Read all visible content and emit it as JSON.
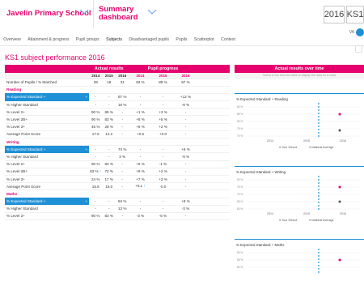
{
  "header": {
    "school": "Javelin Primary School",
    "dashboard_line1": "Summary",
    "dashboard_line2": "dashboard",
    "year": "2016",
    "stage": "KS1",
    "toggle_label": "VA"
  },
  "nav": [
    "Overview",
    "Attainment & progress",
    "Pupil groups",
    "Subjects",
    "Disadvantaged pupils",
    "Pupils",
    "Scatterplot",
    "Context"
  ],
  "nav_active": "Subjects",
  "page_title": "KS1 subject performance 2016",
  "table": {
    "actual_header": "Actual results",
    "progress_header": "Pupil progress",
    "over_time_header": "Actual results over time",
    "over_time_hint": "Select a row from the table to display the data on a chart",
    "years": [
      "2014",
      "2015",
      "2016"
    ],
    "pupils_label": "Number of Pupils / % Matched",
    "pupils": [
      "29",
      "18",
      "31",
      "93 %",
      "89 %",
      "97 %"
    ],
    "sections": [
      {
        "title": "Reading",
        "rows": [
          {
            "label": "% Expected Standard +",
            "v": [
              "-",
              "-",
              "87 %",
              "-",
              "-",
              "+12 %"
            ],
            "sel": true
          },
          {
            "label": "% Higher Standard",
            "v": [
              "-",
              "-",
              "16 %",
              "-",
              "-",
              "-8 %"
            ]
          },
          {
            "label": "% Level 2+",
            "v": [
              "90 %",
              "89 %",
              "-",
              "+1 %",
              "+3 %",
              "-"
            ]
          },
          {
            "label": "% Level 2B+",
            "v": [
              "90 %",
              "83 %",
              "-",
              "+8 %",
              "+5 %",
              "-"
            ]
          },
          {
            "label": "% Level 3+",
            "v": [
              "45 %",
              "28 %",
              "-",
              "+6 %",
              "+2 %",
              "-"
            ]
          },
          {
            "label": "Average Point Score",
            "v": [
              "17.5",
              "14.2",
              "-",
              "+0.5",
              "+0.0",
              "-"
            ]
          }
        ]
      },
      {
        "title": "Writing",
        "rows": [
          {
            "label": "% Expected Standard +",
            "v": [
              "-",
              "-",
              "74 %",
              "-",
              "-",
              "+6 %"
            ],
            "sel": true
          },
          {
            "label": "% Higher Standard",
            "v": [
              "-",
              "-",
              "3 %",
              "-",
              "-",
              "-9 %"
            ]
          },
          {
            "label": "% Level 2+",
            "v": [
              "90 %",
              "83 %",
              "-",
              "+6 %",
              "-1 %",
              "-"
            ]
          },
          {
            "label": "% Level 2B+",
            "v": [
              "83 %",
              "72 %",
              "-",
              "+9 %",
              "+2 %",
              "-"
            ],
            "arrow": true
          },
          {
            "label": "% Level 3+",
            "v": [
              "24 %",
              "17 %",
              "-",
              "+7 %",
              "+3 %",
              "-"
            ]
          },
          {
            "label": "Average Point Score",
            "v": [
              "15.6",
              "15.0",
              "-",
              "+0.1",
              "-0.0",
              "-"
            ],
            "arrow2": true
          }
        ]
      },
      {
        "title": "Maths",
        "rows": [
          {
            "label": "% Expected Standard +",
            "v": [
              "-",
              "-",
              "84 %",
              "-",
              "-",
              "+8 %"
            ],
            "sel": true
          },
          {
            "label": "% Higher Standard",
            "v": [
              "-",
              "-",
              "13 %",
              "-",
              "-",
              "-3 %"
            ]
          },
          {
            "label": "% Level 2+",
            "v": [
              "90 %",
              "83 %",
              "-",
              "-3 %",
              "-5 %",
              "-"
            ]
          }
        ]
      }
    ]
  },
  "charts": [
    {
      "title": "% Expected Standard + Reading",
      "yticks": [
        "80 %",
        "85 %",
        "80 %",
        "75 %",
        "70 %"
      ],
      "x": [
        "2014",
        "2015",
        "2016"
      ],
      "legend": [
        "Your School",
        "National Average"
      ]
    },
    {
      "title": "% Expected Standard + Writing",
      "yticks": [
        "80 %",
        "75 %",
        "70 %",
        "65 %",
        "60 %"
      ],
      "x": [
        "2014",
        "2015",
        "2016"
      ],
      "legend": [
        "Your School",
        "National Average"
      ]
    },
    {
      "title": "% Expected Standard + Maths",
      "yticks": [
        "80 %",
        "85 %",
        "80 %"
      ],
      "x": [],
      "legend": []
    }
  ],
  "colors": {
    "accent": "#e6006e",
    "blue": "#1e90d6"
  }
}
